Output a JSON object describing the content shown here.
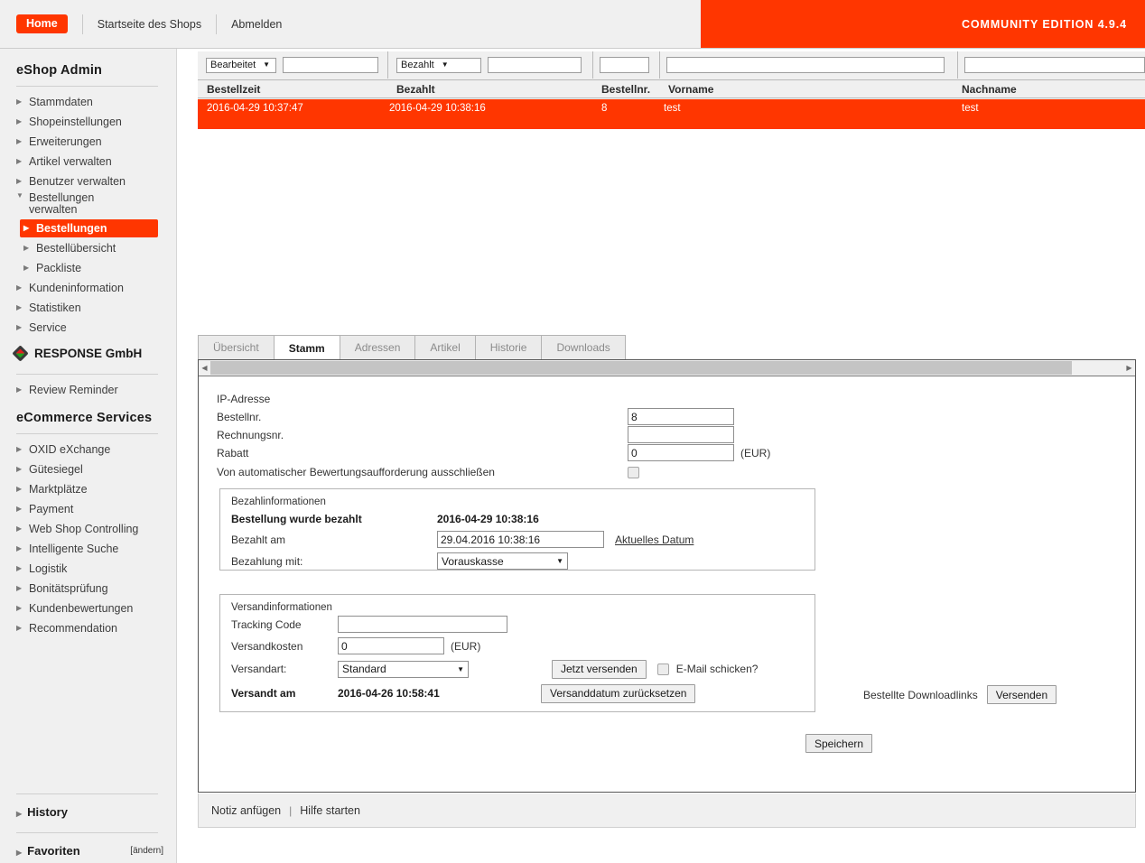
{
  "topbar": {
    "home_label": "Home",
    "shop_home_label": "Startseite des Shops",
    "logout_label": "Abmelden",
    "edition_label": "COMMUNITY EDITION 4.9.4",
    "accent_color": "#ff3600"
  },
  "sidebar": {
    "title": "eShop Admin",
    "items": [
      {
        "label": "Stammdaten"
      },
      {
        "label": "Shopeinstellungen"
      },
      {
        "label": "Erweiterungen"
      },
      {
        "label": "Artikel verwalten"
      },
      {
        "label": "Benutzer verwalten"
      },
      {
        "label": "Bestellungen verwalten"
      },
      {
        "label": "Bestellungen"
      },
      {
        "label": "Bestellübersicht"
      },
      {
        "label": "Packliste"
      },
      {
        "label": "Kundeninformation"
      },
      {
        "label": "Statistiken"
      },
      {
        "label": "Service"
      }
    ],
    "partner": {
      "name": "RESPONSE GmbH",
      "items": [
        {
          "label": "Review Reminder"
        }
      ]
    },
    "services_title": "eCommerce Services",
    "services": [
      {
        "label": "OXID eXchange"
      },
      {
        "label": "Gütesiegel"
      },
      {
        "label": "Marktplätze"
      },
      {
        "label": "Payment"
      },
      {
        "label": "Web Shop Controlling"
      },
      {
        "label": "Intelligente Suche"
      },
      {
        "label": "Logistik"
      },
      {
        "label": "Bonitätsprüfung"
      },
      {
        "label": "Kundenbewertungen"
      },
      {
        "label": "Recommendation"
      }
    ],
    "bottom": {
      "history_label": "History",
      "favorites_label": "Favoriten",
      "change_label": "[ändern]"
    }
  },
  "orderlist": {
    "filters": [
      {
        "type": "select",
        "value": "Bearbeitet"
      },
      {
        "type": "text",
        "value": ""
      },
      {
        "type": "select",
        "value": "Bezahlt"
      },
      {
        "type": "text",
        "value": ""
      },
      {
        "type": "text",
        "value": ""
      },
      {
        "type": "text",
        "value": ""
      },
      {
        "type": "text",
        "value": ""
      }
    ],
    "columns": [
      "Bestellzeit",
      "Bezahlt",
      "Bestellnr.",
      "Vorname",
      "Nachname"
    ],
    "rows": [
      {
        "bestellzeit": "2016-04-29 10:37:47",
        "bezahlt": "2016-04-29 10:38:16",
        "bestellnr": "8",
        "vorname": "test",
        "nachname": "test",
        "selected": true
      }
    ]
  },
  "tabs": [
    {
      "label": "Übersicht",
      "active": false
    },
    {
      "label": "Stamm",
      "active": true
    },
    {
      "label": "Adressen",
      "active": false
    },
    {
      "label": "Artikel",
      "active": false
    },
    {
      "label": "Historie",
      "active": false
    },
    {
      "label": "Downloads",
      "active": false
    }
  ],
  "form": {
    "ip_label": "IP-Adresse",
    "ip_value": "",
    "bestellnr_label": "Bestellnr.",
    "bestellnr_value": "8",
    "rechnungsnr_label": "Rechnungsnr.",
    "rechnungsnr_value": "",
    "rabatt_label": "Rabatt",
    "rabatt_value": "0",
    "rabatt_unit": "(EUR)",
    "exclude_label": "Von automatischer Bewertungsaufforderung ausschließen",
    "exclude_checked": false,
    "payment": {
      "panel_title": "Bezahlinformationen",
      "paid_label": "Bestellung wurde bezahlt",
      "paid_value": "2016-04-29 10:38:16",
      "paid_on_label": "Bezahlt am",
      "paid_on_value": "29.04.2016 10:38:16",
      "current_date_link": "Aktuelles Datum",
      "method_label": "Bezahlung mit:",
      "method_value": "Vorauskasse"
    },
    "shipping": {
      "panel_title": "Versandinformationen",
      "tracking_label": "Tracking Code",
      "tracking_value": "",
      "cost_label": "Versandkosten",
      "cost_value": "0",
      "cost_unit": "(EUR)",
      "type_label": "Versandart:",
      "type_value": "Standard",
      "send_now_button": "Jetzt versenden",
      "email_checkbox_label": "E-Mail schicken?",
      "email_checked": false,
      "shipped_label": "Versandt am",
      "shipped_value": "2016-04-26 10:58:41",
      "reset_button": "Versanddatum zurücksetzen"
    },
    "downloads": {
      "label": "Bestellte Downloadlinks",
      "button": "Versenden"
    },
    "save_button": "Speichern"
  },
  "footer": {
    "note_link": "Notiz anfügen",
    "separator": "|",
    "help_link": "Hilfe starten"
  }
}
